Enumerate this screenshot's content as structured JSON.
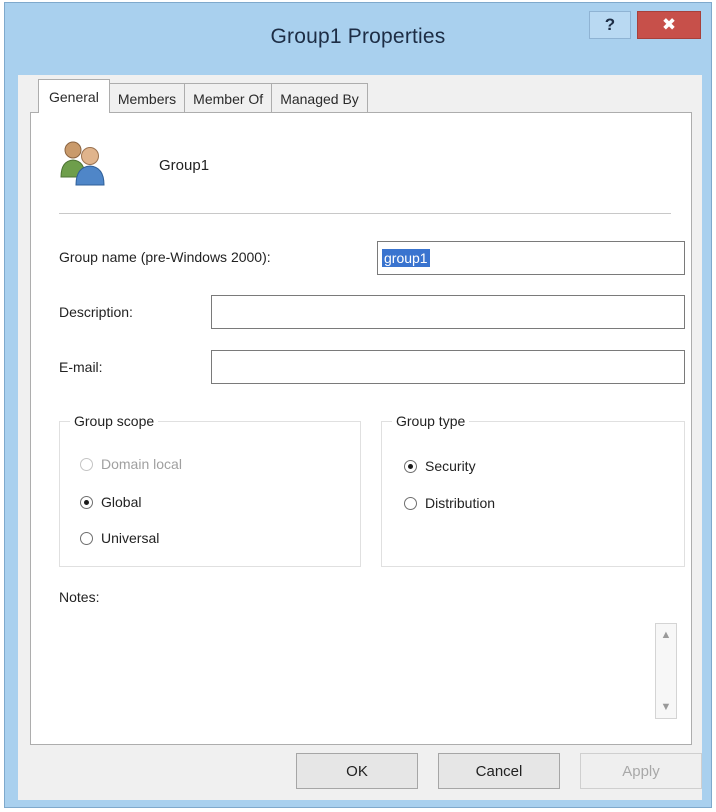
{
  "window": {
    "title": "Group1 Properties",
    "help_label": "?",
    "close_label": "✖"
  },
  "tabs": [
    {
      "label": "General",
      "active": true
    },
    {
      "label": "Members",
      "active": false
    },
    {
      "label": "Member Of",
      "active": false
    },
    {
      "label": "Managed By",
      "active": false
    }
  ],
  "general": {
    "group_name_display": "Group1",
    "prewin2000": {
      "label": "Group name (pre-Windows 2000):",
      "value": "group1"
    },
    "description": {
      "label": "Description:",
      "value": ""
    },
    "email": {
      "label": "E-mail:",
      "value": ""
    },
    "group_scope": {
      "title": "Group scope",
      "options": [
        {
          "label": "Domain local",
          "checked": false,
          "disabled": true
        },
        {
          "label": "Global",
          "checked": true,
          "disabled": false
        },
        {
          "label": "Universal",
          "checked": false,
          "disabled": false
        }
      ]
    },
    "group_type": {
      "title": "Group type",
      "options": [
        {
          "label": "Security",
          "checked": true
        },
        {
          "label": "Distribution",
          "checked": false
        }
      ]
    },
    "notes": {
      "label": "Notes:",
      "value": ""
    }
  },
  "buttons": {
    "ok": "OK",
    "cancel": "Cancel",
    "apply": "Apply"
  },
  "colors": {
    "frame": "#a9d0ee",
    "close": "#c7504a",
    "selection": "#3a74cf"
  },
  "icons": {
    "group": "group-icon",
    "scroll_up": "chevron-up-icon",
    "scroll_down": "chevron-down-icon"
  }
}
